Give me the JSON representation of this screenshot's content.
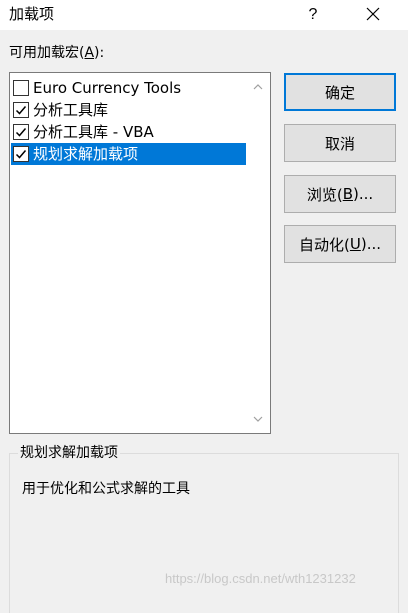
{
  "dialog": {
    "title": "加载项",
    "help_label": "?"
  },
  "addins": {
    "label_prefix": "可用加载宏(",
    "label_access": "A",
    "label_suffix": "):",
    "items": [
      {
        "label": "Euro Currency Tools",
        "checked": false,
        "selected": false
      },
      {
        "label": "分析工具库",
        "checked": true,
        "selected": false
      },
      {
        "label": "分析工具库 - VBA",
        "checked": true,
        "selected": false
      },
      {
        "label": "规划求解加载项",
        "checked": true,
        "selected": true
      }
    ]
  },
  "buttons": {
    "ok": "确定",
    "cancel": "取消",
    "browse_prefix": "浏览(",
    "browse_access": "B",
    "browse_suffix": ")...",
    "automation_prefix": "自动化(",
    "automation_access": "U",
    "automation_suffix": ")..."
  },
  "description": {
    "title": "规划求解加载项",
    "text": "用于优化和公式求解的工具"
  },
  "watermark": "https://blog.csdn.net/wth1231232",
  "colors": {
    "accent": "#0078d7",
    "window_bg": "#f0f0f0"
  }
}
